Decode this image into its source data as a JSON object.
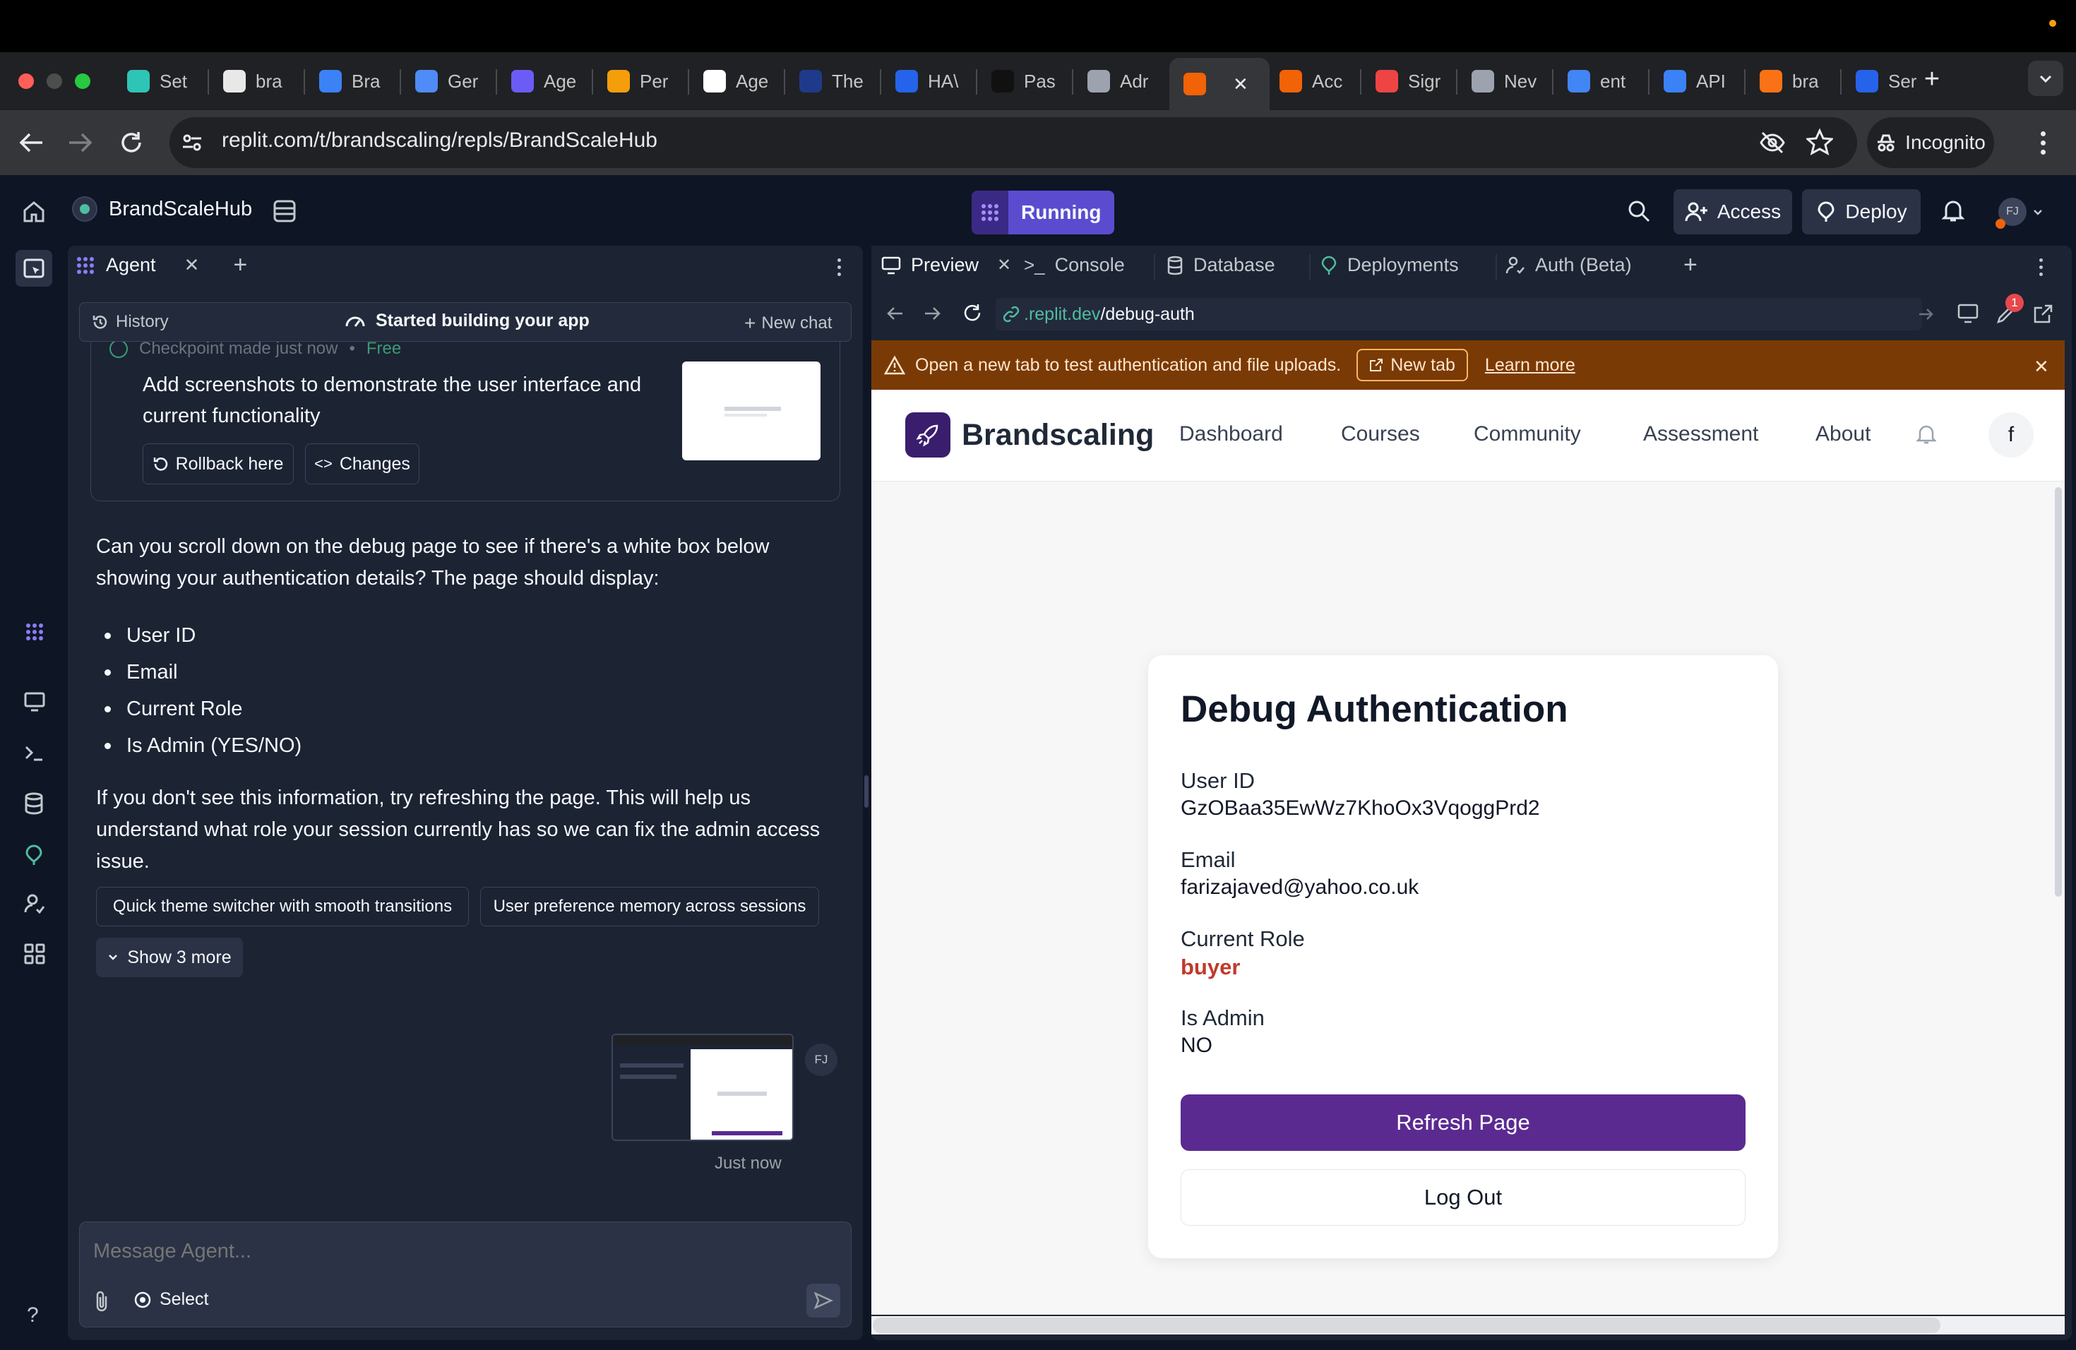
{
  "browser": {
    "tabs": [
      {
        "label": "Set",
        "color": "#2ec4b6"
      },
      {
        "label": "bra",
        "color": "#e8e8e8"
      },
      {
        "label": "Bra",
        "color": "#3b82f6"
      },
      {
        "label": "Ger",
        "color": "#4f8cf7"
      },
      {
        "label": "Age",
        "color": "#6b5cf6"
      },
      {
        "label": "Per",
        "color": "#f59e0b"
      },
      {
        "label": "Age",
        "color": "#ffffff"
      },
      {
        "label": "The",
        "color": "#1e3a8a"
      },
      {
        "label": "HA\\",
        "color": "#2563eb"
      },
      {
        "label": "Pas",
        "color": "#111111"
      },
      {
        "label": "Adr",
        "color": "#9ca3af"
      },
      {
        "label": "",
        "color": "#f26207"
      },
      {
        "label": "Acc",
        "color": "#f26207"
      },
      {
        "label": "Sigr",
        "color": "#ef4444"
      },
      {
        "label": "Nev",
        "color": "#9ca3af"
      },
      {
        "label": "ent",
        "color": "#4285f4"
      },
      {
        "label": "API",
        "color": "#3b82f6"
      },
      {
        "label": "bra",
        "color": "#f97316"
      },
      {
        "label": "Ser",
        "color": "#2563eb"
      }
    ],
    "url": "replit.com/t/brandscaling/repls/BrandScaleHub",
    "incognito_label": "Incognito"
  },
  "replit": {
    "project_name": "BrandScaleHub",
    "status": "Running",
    "access_label": "Access",
    "deploy_label": "Deploy",
    "avatar_initials": "FJ"
  },
  "agent": {
    "tab_label": "Agent",
    "history_label": "History",
    "status_label": "Started building your app",
    "new_chat_label": "New chat",
    "checkpoint_text": "Checkpoint made just now",
    "checkpoint_cost": "Free",
    "checkpoint_message": "Add screenshots to demonstrate the user interface and current functionality",
    "rollback_label": "Rollback here",
    "changes_label": "Changes",
    "message_intro": "Can you scroll down on the debug page to see if there's a white box below showing your authentication details? The page should display:",
    "bullets": [
      "User ID",
      "Email",
      "Current Role",
      "Is Admin (YES/NO)"
    ],
    "message_outro": "If you don't see this information, try refreshing the page. This will help us understand what role your session currently has so we can fix the admin access issue.",
    "suggestions": [
      "Quick theme switcher with smooth transitions",
      "User preference memory across sessions"
    ],
    "show_more_label": "Show 3 more",
    "user_initials": "FJ",
    "timestamp": "Just now",
    "input_placeholder": "Message Agent...",
    "select_label": "Select"
  },
  "workspace": {
    "tabs": [
      "Preview",
      "Console",
      "Database",
      "Deployments",
      "Auth (Beta)"
    ],
    "preview_url_prefix": ".replit.dev",
    "preview_url_path": "/debug-auth",
    "notification_count": "1",
    "banner_text": "Open a new tab to test authentication and file uploads.",
    "banner_button": "New tab",
    "banner_link": "Learn more"
  },
  "site": {
    "brand": "Brandscaling",
    "nav": [
      "Dashboard",
      "Courses",
      "Community",
      "Assessment",
      "About"
    ],
    "profile_initial": "f",
    "card_title": "Debug Authentication",
    "fields": {
      "user_id_label": "User ID",
      "user_id_value": "GzOBaa35EwWz7KhoOx3VqoggPrd2",
      "email_label": "Email",
      "email_value": "farizajaved@yahoo.co.uk",
      "role_label": "Current Role",
      "role_value": "buyer",
      "admin_label": "Is Admin",
      "admin_value": "NO"
    },
    "refresh_label": "Refresh Page",
    "logout_label": "Log Out",
    "colors": {
      "primary": "#5b2a91",
      "role": "#c0392b"
    }
  }
}
